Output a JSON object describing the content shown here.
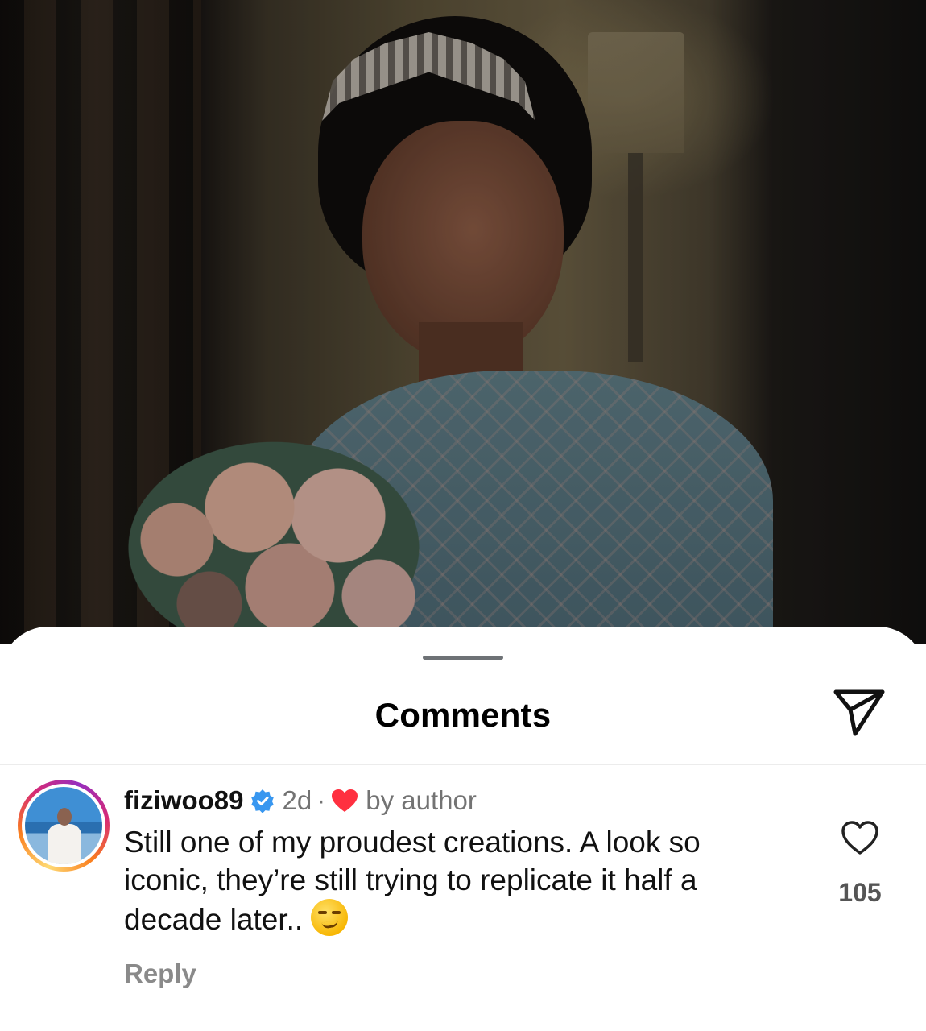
{
  "sheet": {
    "title": "Comments",
    "share_icon": "paper-plane-icon"
  },
  "comment": {
    "username": "fiziwoo89",
    "verified": true,
    "time": "2d",
    "separator": "·",
    "liked_by_author_label": "by author",
    "text": "Still one of my proudest creations. A look so iconic, they’re still trying to replicate it half a decade later..",
    "emoji_name": "smirking-face",
    "reply_label": "Reply",
    "like_count": "105"
  },
  "colors": {
    "verified_blue": "#3897f0",
    "author_heart_red": "#ff3040",
    "secondary_text": "#737373"
  }
}
